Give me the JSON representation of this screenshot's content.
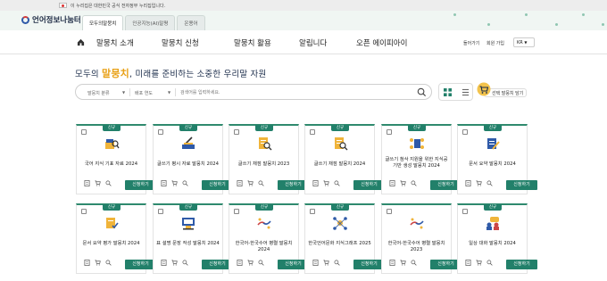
{
  "notice": {
    "text": "이 누리집은 대한민국 공식 전자정부 누리집입니다."
  },
  "brand": {
    "name": "언어정보나눔터"
  },
  "site_tabs": [
    "모두의말뭉치",
    "인공지능(AI)말평",
    "온용어"
  ],
  "menu": [
    "말뭉치 소개",
    "말뭉치 신청",
    "말뭉치 활용",
    "알립니다",
    "오픈 에이피아이"
  ],
  "util": {
    "signin": "들어가기",
    "join": "회원 가입",
    "lang": "KR"
  },
  "headline": {
    "prefix": "모두의 ",
    "em": "말뭉치",
    "rest": ", 미래를 준비하는 소중한 우리말 자원"
  },
  "search": {
    "type_label": "말뭉치 분류",
    "year_label": "배포 연도",
    "placeholder": "검색어를 입력하세요."
  },
  "cart": {
    "label": "선택 말뭉치 담기"
  },
  "card_common": {
    "badge": "신규",
    "apply": "신청하기"
  },
  "cards": [
    {
      "title": "국어 지식 기표 자료 2024",
      "icon": "book-search-icon",
      "new": true
    },
    {
      "title": "글쓰기 평시 자료 말뭉치 2024",
      "icon": "pen-paper-icon",
      "new": true
    },
    {
      "title": "글쓰기 채점 말뭉치 2023",
      "icon": "document-magnifier-icon",
      "new": true
    },
    {
      "title": "글쓰기 채점 말뭉치 2024",
      "icon": "document-magnifier-icon",
      "new": true
    },
    {
      "title": "글쓰기 첨삭 지원을 위한 지식공 기반 생성 말뭉치 2024",
      "icon": "network-doc-icon",
      "new": true
    },
    {
      "title": "문서 요약 말뭉치 2024",
      "icon": "document-pencil-icon",
      "new": true
    },
    {
      "title": "문서 요약 평가 말뭉치 2024",
      "icon": "document-check-icon",
      "new": true
    },
    {
      "title": "표 설명 문장 작성 말뭉치 2024",
      "icon": "table-screen-icon",
      "new": true
    },
    {
      "title": "한국어-한국수어 병렬 말뭉치 2024",
      "icon": "hands-network-icon",
      "new": true
    },
    {
      "title": "한국언어문화 지식그래프 2025",
      "icon": "graph-nodes-icon",
      "new": true
    },
    {
      "title": "한국어-한국수어 병렬 말뭉치 2023",
      "icon": "hands-network-icon",
      "new": false
    },
    {
      "title": "일상 대화 말뭉치 2024",
      "icon": "chat-people-icon",
      "new": true
    }
  ],
  "colors": {
    "accent": "#22806a",
    "brand_navy": "#1b2c4a",
    "highlight": "#e8a015"
  }
}
